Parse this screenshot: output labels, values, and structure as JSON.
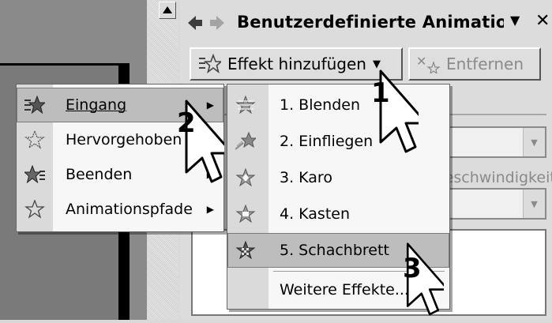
{
  "task_pane": {
    "title": "Benutzerdefinierte Animation",
    "add_effect_label": "Effekt hinzufügen",
    "remove_label": "Entfernen",
    "speed_label": "Geschwindigkeit:"
  },
  "main_menu": {
    "items": [
      {
        "label": "Eingang",
        "icon": "entrance-star-icon",
        "highlighted": true
      },
      {
        "label": "Hervorgehoben",
        "icon": "emphasis-star-icon"
      },
      {
        "label": "Beenden",
        "icon": "exit-star-icon"
      },
      {
        "label": "Animationspfade",
        "icon": "motion-path-star-icon"
      }
    ]
  },
  "sub_menu": {
    "items": [
      {
        "label": "1. Blenden",
        "icon": "blinds-icon"
      },
      {
        "label": "2. Einfliegen",
        "icon": "fly-in-icon"
      },
      {
        "label": "3. Karo",
        "icon": "checkerboard-icon"
      },
      {
        "label": "4. Kasten",
        "icon": "box-icon"
      },
      {
        "label": "5. Schachbrett",
        "icon": "chessboard-icon",
        "highlighted": true
      }
    ],
    "more_label": "Weitere Effekte..."
  },
  "callouts": [
    "1",
    "2",
    "3"
  ],
  "colors": {
    "highlight": "#bdbdbd",
    "pane": "#dcdcdc",
    "menu_bg": "#f7f7f7"
  }
}
